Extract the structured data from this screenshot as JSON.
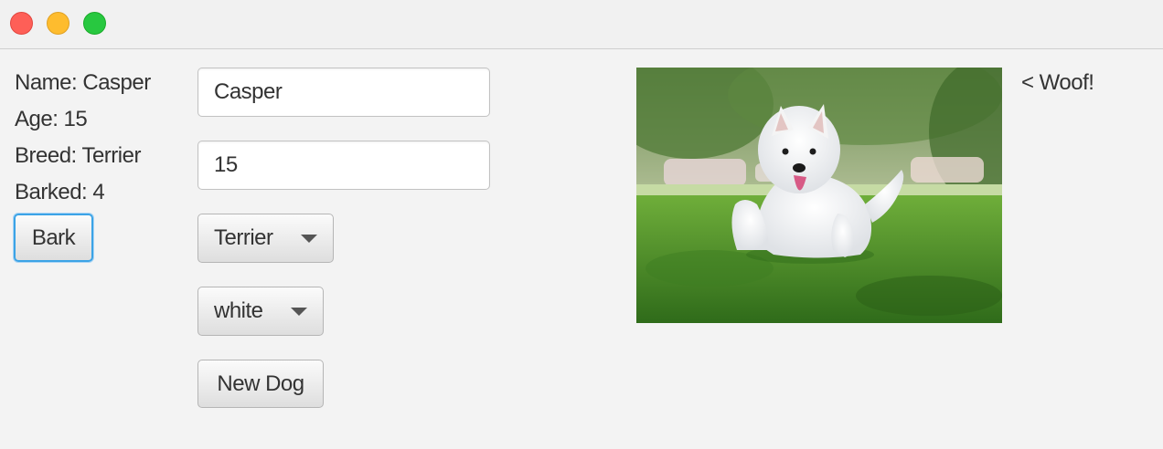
{
  "window": {
    "controls": {
      "close": "close-button",
      "minimize": "minimize-button",
      "maximize": "zoom-button"
    },
    "colors": {
      "close": "#fe5f57",
      "minimize": "#febc2e",
      "maximize": "#28c840",
      "focus_ring": "#3ba3e6"
    }
  },
  "info": {
    "name_label": "Name: Casper",
    "age_label": "Age: 15",
    "breed_label": "Breed: Terrier",
    "barked_label": "Barked: 4"
  },
  "buttons": {
    "bark": "Bark",
    "new_dog": "New Dog"
  },
  "form": {
    "name_value": "Casper",
    "age_value": "15",
    "breed_selected": "Terrier",
    "color_selected": "white"
  },
  "image": {
    "subject": "white terrier dog on grass"
  },
  "speech": "< Woof!"
}
